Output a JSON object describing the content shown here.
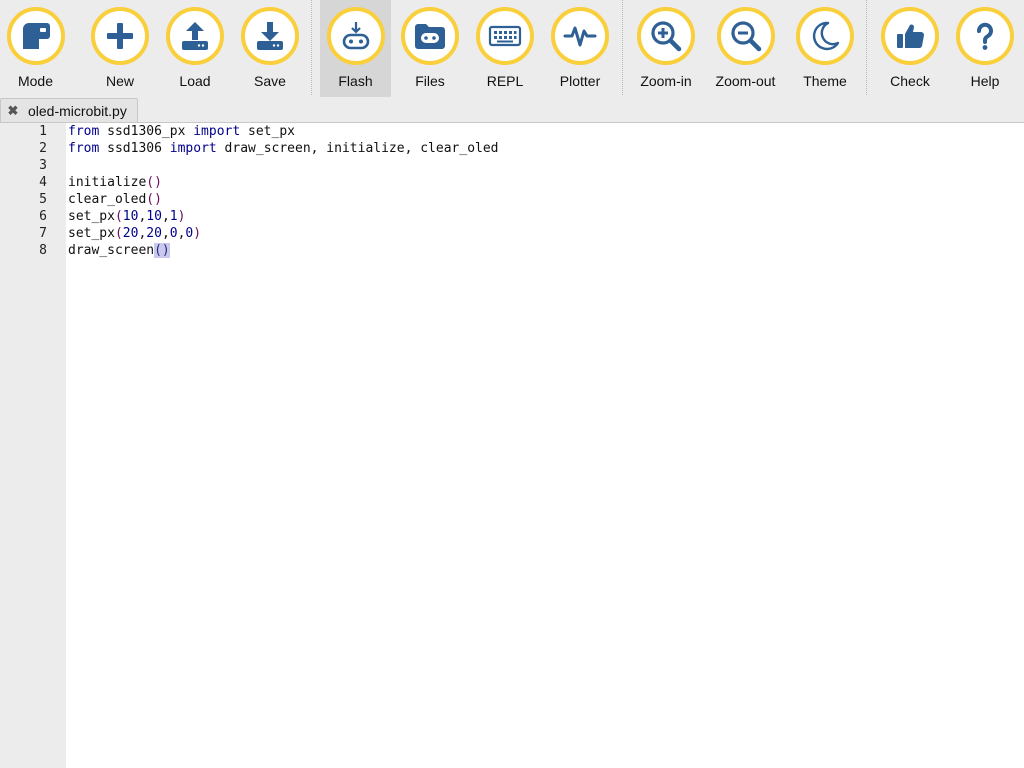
{
  "toolbar": {
    "buttons": [
      {
        "id": "mode",
        "label": "Mode",
        "icon": "mode-icon"
      },
      {
        "id": "new",
        "label": "New",
        "icon": "plus-icon"
      },
      {
        "id": "load",
        "label": "Load",
        "icon": "upload-icon"
      },
      {
        "id": "save",
        "label": "Save",
        "icon": "download-icon"
      },
      {
        "id": "flash",
        "label": "Flash",
        "icon": "flash-device-icon",
        "active": true
      },
      {
        "id": "files",
        "label": "Files",
        "icon": "files-device-icon"
      },
      {
        "id": "repl",
        "label": "REPL",
        "icon": "keyboard-icon"
      },
      {
        "id": "plotter",
        "label": "Plotter",
        "icon": "pulse-icon"
      },
      {
        "id": "zoom-in",
        "label": "Zoom-in",
        "icon": "zoom-in-icon"
      },
      {
        "id": "zoom-out",
        "label": "Zoom-out",
        "icon": "zoom-out-icon"
      },
      {
        "id": "theme",
        "label": "Theme",
        "icon": "moon-icon"
      },
      {
        "id": "check",
        "label": "Check",
        "icon": "thumbs-up-icon"
      },
      {
        "id": "help",
        "label": "Help",
        "icon": "question-icon"
      }
    ]
  },
  "tabs": [
    {
      "label": "oled-microbit.py",
      "close_glyph": "✖"
    }
  ],
  "editor": {
    "lines": [
      {
        "number": "1",
        "text": "from ssd1306_px import set_px"
      },
      {
        "number": "2",
        "text": "from ssd1306 import draw_screen, initialize, clear_oled"
      },
      {
        "number": "3",
        "text": ""
      },
      {
        "number": "4",
        "text": "initialize()"
      },
      {
        "number": "5",
        "text": "clear_oled()"
      },
      {
        "number": "6",
        "text": "set_px(10,10,1)"
      },
      {
        "number": "7",
        "text": "set_px(20,20,0,0)"
      },
      {
        "number": "8",
        "text": "draw_screen()"
      }
    ]
  },
  "colors": {
    "icon": "#2e5f95",
    "ring": "#f9cf3b",
    "keyword": "#00008b",
    "bracket_match": "#c9c9ef"
  }
}
